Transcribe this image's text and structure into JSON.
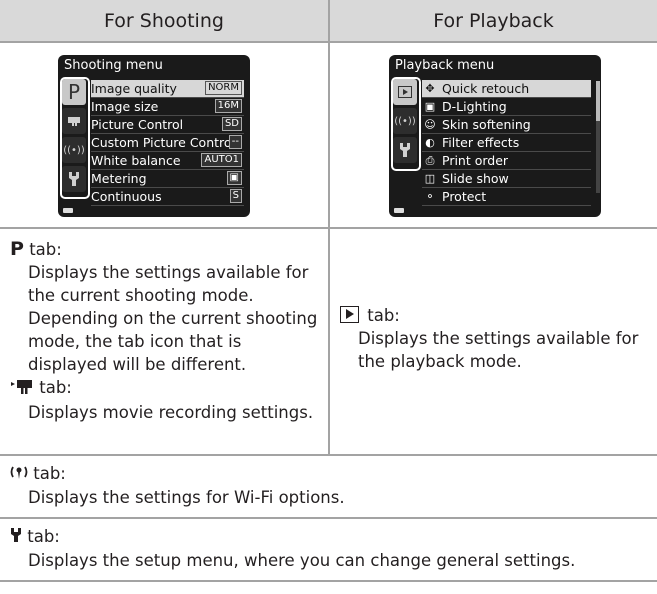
{
  "header": {
    "left": "For Shooting",
    "right": "For Playback"
  },
  "shooting_screen": {
    "title": "Shooting menu",
    "tabs": [
      "P",
      "movie-icon",
      "wifi-icon",
      "wrench-icon"
    ],
    "items": [
      {
        "label": "Image quality",
        "value": "NORM"
      },
      {
        "label": "Image size",
        "value": "16M"
      },
      {
        "label": "Picture Control",
        "value": "SD"
      },
      {
        "label": "Custom Picture Control",
        "value": "--"
      },
      {
        "label": "White balance",
        "value": "AUTO1"
      },
      {
        "label": "Metering",
        "value": "▣"
      },
      {
        "label": "Continuous",
        "value": "S"
      }
    ]
  },
  "playback_screen": {
    "title": "Playback menu",
    "tabs": [
      "play-icon",
      "wifi-icon",
      "wrench-icon"
    ],
    "items": [
      {
        "label": "Quick retouch",
        "icon": "retouch-icon"
      },
      {
        "label": "D-Lighting",
        "icon": "d-lighting-icon"
      },
      {
        "label": "Skin softening",
        "icon": "skin-softening-icon"
      },
      {
        "label": "Filter effects",
        "icon": "filter-effects-icon"
      },
      {
        "label": "Print order",
        "icon": "print-icon"
      },
      {
        "label": "Slide show",
        "icon": "slide-show-icon"
      },
      {
        "label": "Protect",
        "icon": "key-icon"
      }
    ]
  },
  "p_tab": {
    "label": "tab:",
    "desc": "Displays the settings available for the current shooting mode. Depending on the current shooting mode, the tab icon that is displayed will be different."
  },
  "movie_tab": {
    "label": "tab:",
    "desc": "Displays movie recording settings."
  },
  "play_tab": {
    "label": "tab:",
    "desc": "Displays the settings available for the playback mode."
  },
  "wifi_tab": {
    "label": "tab:",
    "desc": "Displays the settings for Wi-Fi options."
  },
  "setup_tab": {
    "label": "tab:",
    "desc": "Displays the setup menu, where you can change general settings."
  },
  "colors": {
    "header_bg": "#d9d9d9",
    "rule": "#a3a3a3",
    "screen_bg": "#1a1a1a",
    "highlight": "#d7d7d7"
  }
}
